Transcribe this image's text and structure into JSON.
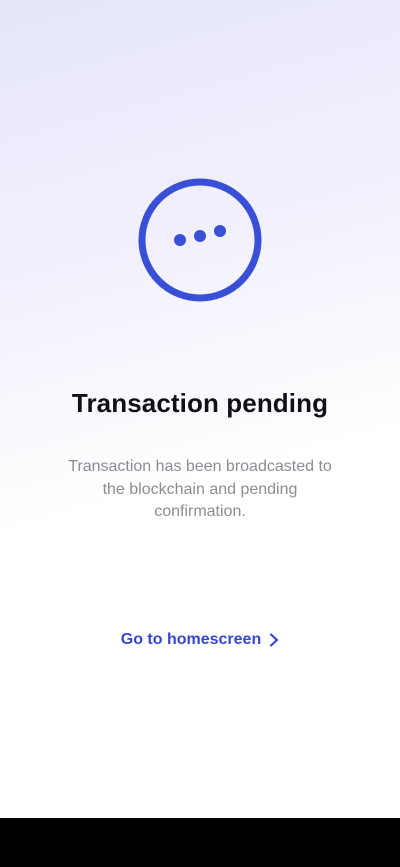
{
  "status": {
    "icon": "pending-dots-icon",
    "accent_color": "#3a4fd8"
  },
  "title": "Transaction pending",
  "description": "Transaction has been broadcasted to the blockchain and pending confirmation.",
  "home_link": {
    "label": "Go to homescreen",
    "icon": "chevron-right-icon",
    "color": "#3347d1"
  }
}
